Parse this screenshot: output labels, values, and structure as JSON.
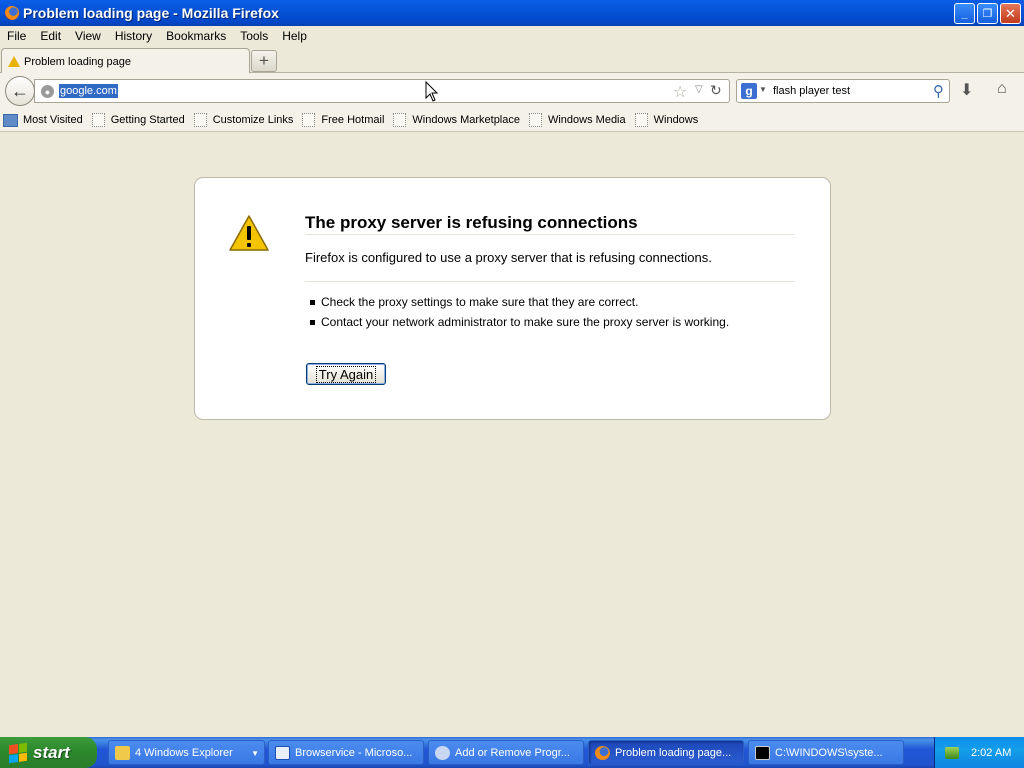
{
  "window": {
    "title": "Problem loading page - Mozilla Firefox",
    "controls": {
      "minimize": "_",
      "restore": "❐",
      "close": "✕"
    }
  },
  "menu": [
    "File",
    "Edit",
    "View",
    "History",
    "Bookmarks",
    "Tools",
    "Help"
  ],
  "tabs": {
    "active_label": "Problem loading page",
    "new_tab_label": "+"
  },
  "nav": {
    "back_glyph": "←",
    "url": "google.com",
    "search_text": "flash player test",
    "search_engine_glyph": "g"
  },
  "bookmarks": [
    "Most Visited",
    "Getting Started",
    "Customize Links",
    "Free Hotmail",
    "Windows Marketplace",
    "Windows Media",
    "Windows"
  ],
  "error": {
    "title": "The proxy server is refusing connections",
    "description": "Firefox is configured to use a proxy server that is refusing connections.",
    "items": [
      "Check the proxy settings to make sure that they are correct.",
      "Contact your network administrator to make sure the proxy server is working."
    ],
    "button": "Try Again"
  },
  "taskbar": {
    "start_label": "start",
    "buttons": [
      {
        "label": "4 Windows Explorer",
        "icon": "folder-icon"
      },
      {
        "label": "Browservice - Microso...",
        "icon": "document-icon"
      },
      {
        "label": "Add or Remove Progr...",
        "icon": "programs-icon"
      },
      {
        "label": "Problem loading page...",
        "icon": "firefox-icon"
      },
      {
        "label": "C:\\WINDOWS\\syste...",
        "icon": "cmd-icon"
      }
    ],
    "clock": "2:02 AM"
  },
  "colors": {
    "titlebar": "#0553d8",
    "taskbar": "#2157d7",
    "start": "#2e8b2e",
    "warning": "#e8b200",
    "selection": "#316ac5"
  }
}
